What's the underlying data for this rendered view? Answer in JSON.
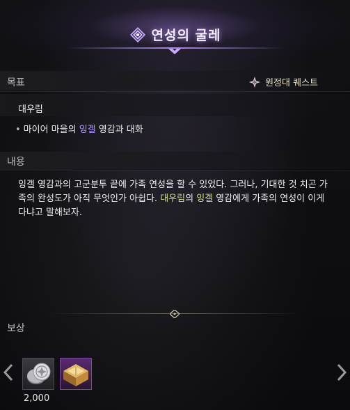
{
  "window": {
    "title": "연성의 굴레"
  },
  "objective_section": {
    "label": "목표",
    "quest_type": "원정대 퀘스트",
    "quest_name": "대우림",
    "objective": {
      "prefix": "마이어 마을의 ",
      "npc": "잉겔",
      "suffix": " 영감과 대화"
    }
  },
  "content_section": {
    "label": "내용",
    "text_part1": "잉겔 영감과의 고군분투 끝에 가족 연성을 할 수 있었다. 그러나, 기대한 것 치곤 가족의 완성도가 아직 무엇인가 아쉽다. ",
    "place_highlight": "대우림",
    "text_part2": "의 ",
    "npc_highlight": "잉겔",
    "text_part3": " 영감에게 가족의 연성이 이게 다냐고 말해보자."
  },
  "reward_section": {
    "label": "보상",
    "rewards": [
      {
        "icon": "silver-coin-icon",
        "quantity": "2,000"
      },
      {
        "icon": "golden-chest-icon",
        "quantity": ""
      }
    ]
  },
  "colors": {
    "accent_purple": "#b69bff",
    "accent_green": "#c7e17a"
  }
}
